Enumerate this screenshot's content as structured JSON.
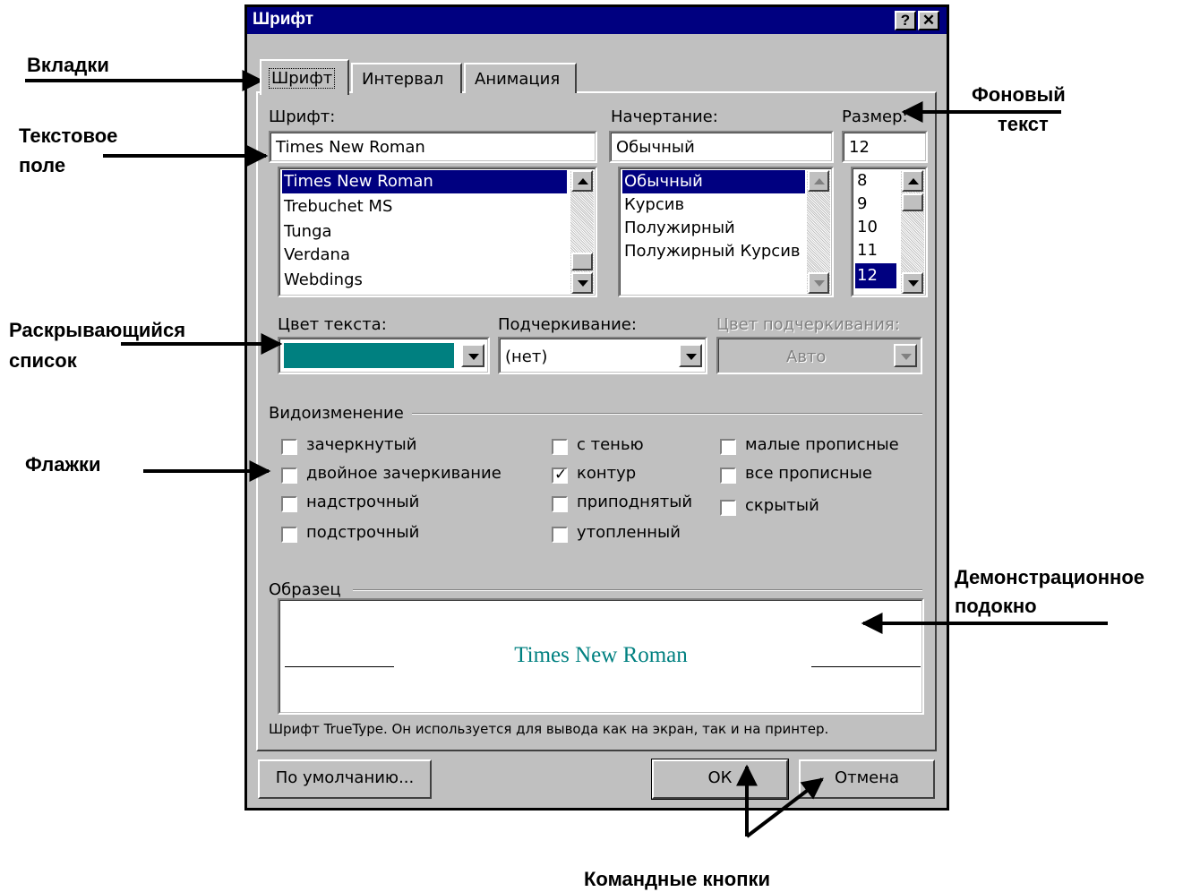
{
  "annotations": {
    "tabs": "Вкладки",
    "text_field_1": "Текстовое",
    "text_field_2": "поле",
    "dropdown_1": "Раскрывающийся",
    "dropdown_2": "список",
    "checkboxes": "Флажки",
    "background_text_1": "Фоновый",
    "background_text_2": "текст",
    "preview_1": "Демонстрационное",
    "preview_2": "подокно",
    "command_buttons": "Командные кнопки"
  },
  "dialog": {
    "title": "Шрифт",
    "help_button": "?",
    "close_button": "✕",
    "tabs": [
      "Шрифт",
      "Интервал",
      "Анимация"
    ],
    "font": {
      "label": "Шрифт:",
      "value": "Times New Roman",
      "items": [
        "Times New Roman",
        "Trebuchet MS",
        "Tunga",
        "Verdana",
        "Webdings"
      ],
      "selected": "Times New Roman"
    },
    "style": {
      "label": "Начертание:",
      "value": "Обычный",
      "items": [
        "Обычный",
        "Курсив",
        "Полужирный",
        "Полужирный Курсив"
      ],
      "selected": "Обычный"
    },
    "size": {
      "label": "Размер:",
      "value": "12",
      "items": [
        "8",
        "9",
        "10",
        "11",
        "12"
      ],
      "selected": "12"
    },
    "text_color": {
      "label": "Цвет текста:",
      "color": "#008080"
    },
    "underline": {
      "label": "Подчеркивание:",
      "value": "(нет)"
    },
    "underline_color": {
      "label": "Цвет подчеркивания:",
      "value": "Авто"
    },
    "effects": {
      "label": "Видоизменение",
      "items": [
        {
          "label": "зачеркнутый",
          "checked": false
        },
        {
          "label": "двойное зачеркивание",
          "checked": false
        },
        {
          "label": "надстрочный",
          "checked": false
        },
        {
          "label": "подстрочный",
          "checked": false
        },
        {
          "label": "с тенью",
          "checked": false
        },
        {
          "label": "контур",
          "checked": true
        },
        {
          "label": "приподнятый",
          "checked": false
        },
        {
          "label": "утопленный",
          "checked": false
        },
        {
          "label": "малые прописные",
          "checked": false
        },
        {
          "label": "все прописные",
          "checked": false
        },
        {
          "label": "скрытый",
          "checked": false
        }
      ]
    },
    "preview": {
      "label": "Образец",
      "sample_text": "Times New Roman",
      "description": "Шрифт TrueType. Он используется для вывода как на экран, так и на принтер."
    },
    "buttons": {
      "default": "По умолчанию...",
      "ok": "ОК",
      "cancel": "Отмена"
    }
  }
}
